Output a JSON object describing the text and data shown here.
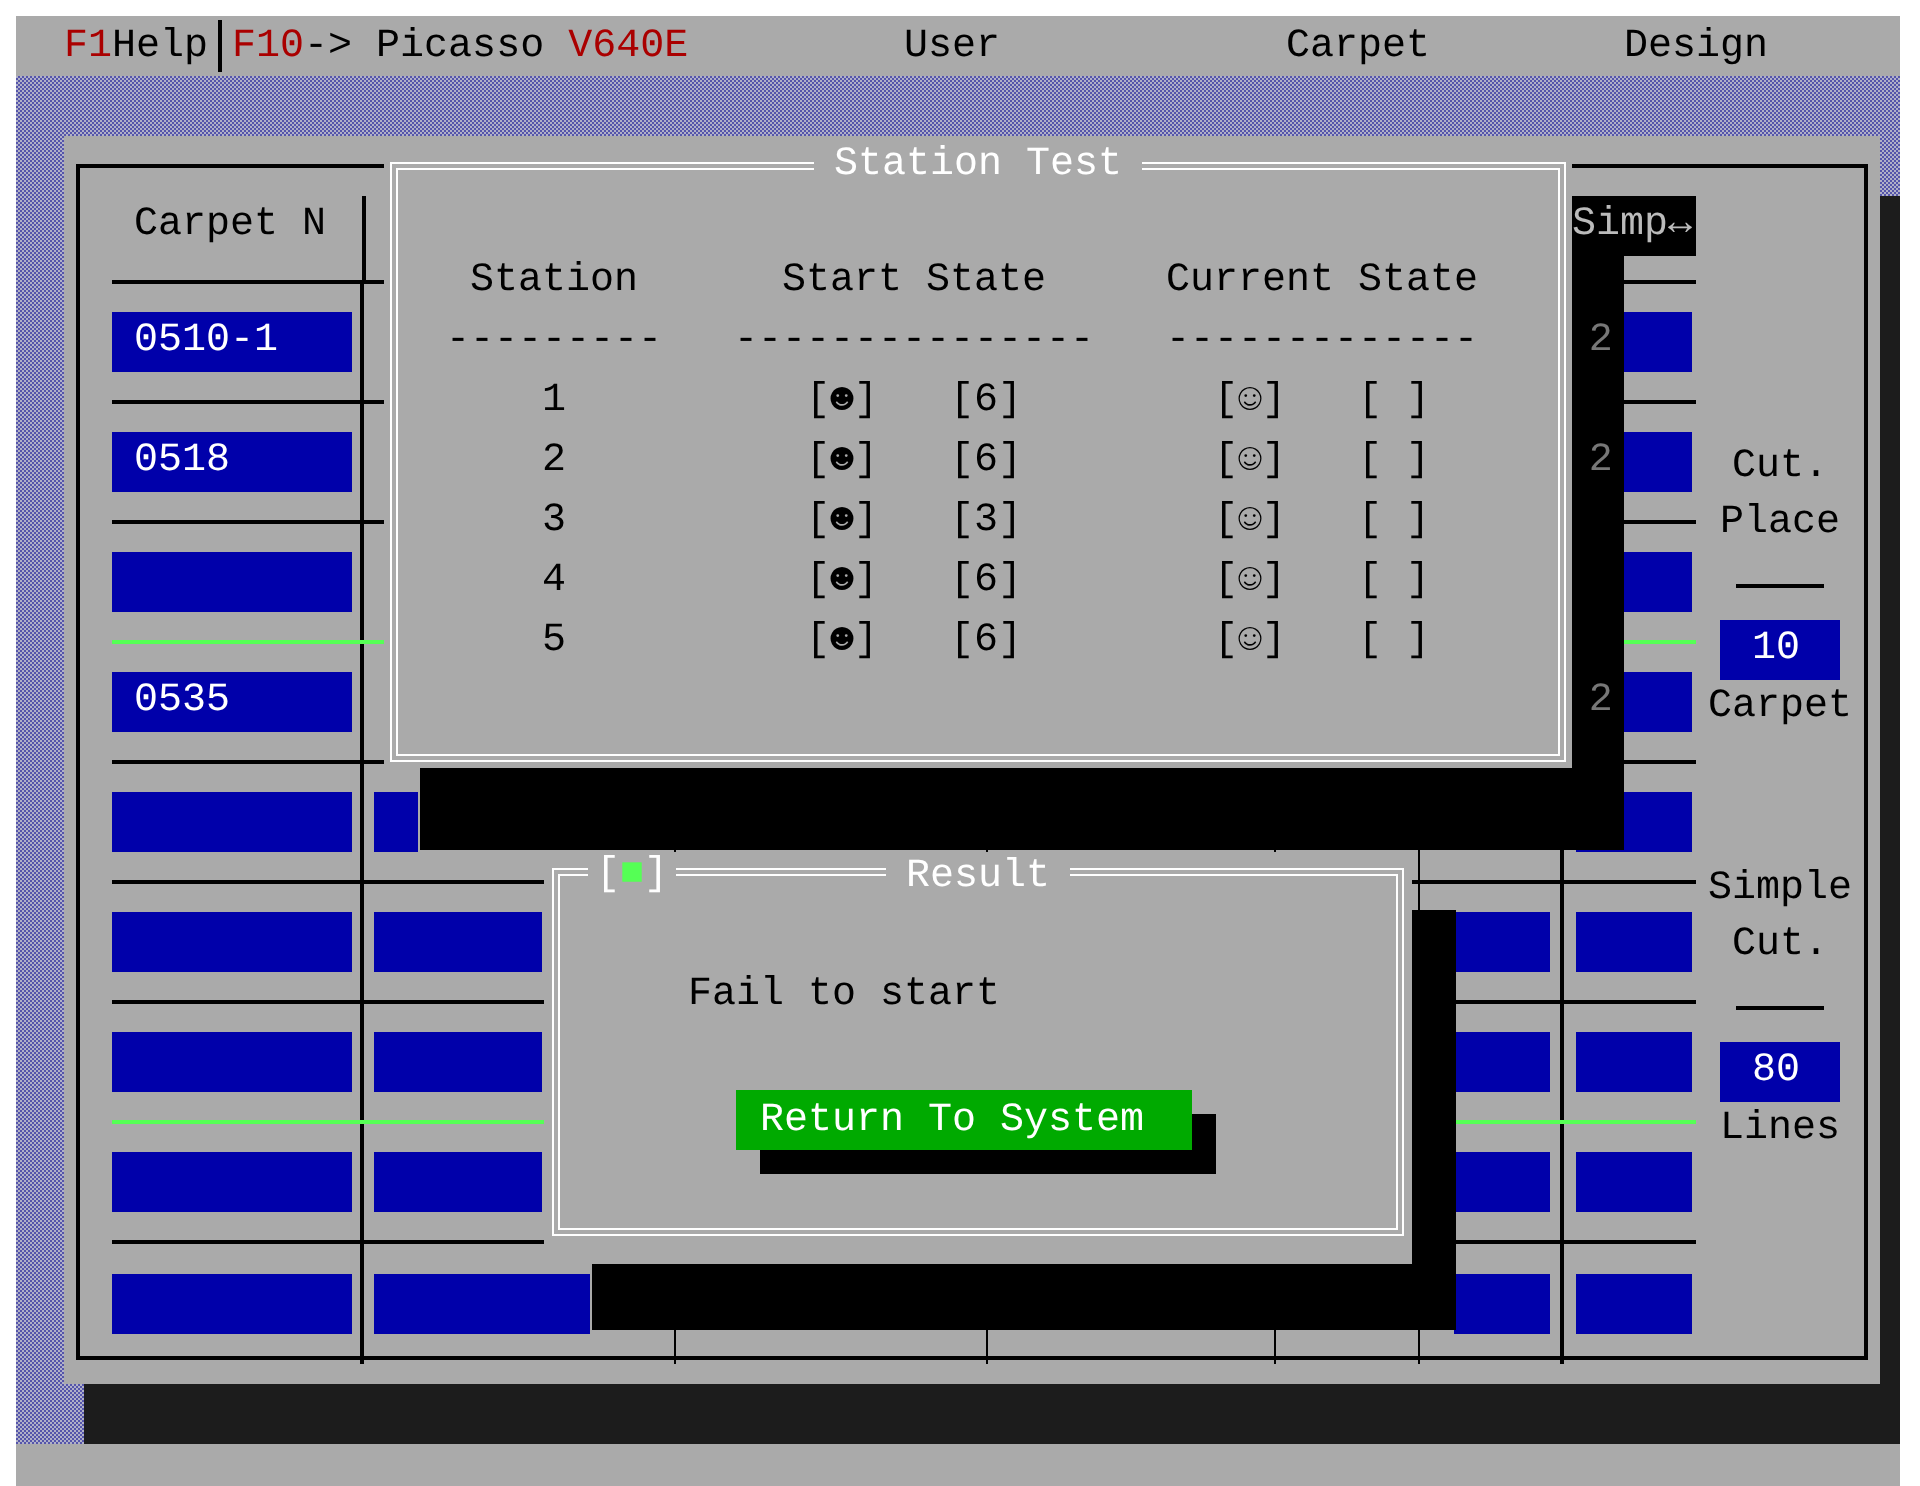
{
  "top_bar": {
    "hotkeys": [
      {
        "key": "F1",
        "label": "Help"
      },
      {
        "key": "F10",
        "label": "-> Picasso",
        "version": "V640E"
      }
    ],
    "menus": [
      "User",
      "Carpet",
      "Design"
    ]
  },
  "table": {
    "headers": {
      "carpet_no": "Carpet N",
      "column_7": "Simp↔"
    },
    "rows": [
      {
        "carpet_no": "0510-1",
        "column_7": "2",
        "highlighted_line": false
      },
      {
        "carpet_no": "0518",
        "column_7": "2",
        "highlighted_line": false
      },
      {
        "highlighted_line": true
      },
      {
        "carpet_no": "0535",
        "column_7": "2",
        "highlighted_line": false
      },
      {
        "highlighted_line": false
      },
      {
        "highlighted_line": false
      },
      {
        "highlighted_line": true
      },
      {
        "highlighted_line": false
      },
      {}
    ]
  },
  "sidebar": [
    {
      "labels": [
        "Cut.",
        "Place"
      ],
      "value": "10",
      "caption": "Carpet"
    },
    {
      "labels": [
        "Simple",
        "Cut."
      ],
      "value": "80",
      "caption": "Lines"
    }
  ],
  "station_test": {
    "title": "Station Test",
    "columns": [
      "Station",
      "Start State",
      "Current State"
    ],
    "dividers": [
      "---------",
      "---------------",
      "-------------"
    ],
    "rows": [
      {
        "station": "1",
        "start_mark": "[☻]",
        "start_count": "[6]",
        "current_mark": "[☺]",
        "current_count": "[ ]"
      },
      {
        "station": "2",
        "start_mark": "[☻]",
        "start_count": "[6]",
        "current_mark": "[☺]",
        "current_count": "[ ]"
      },
      {
        "station": "3",
        "start_mark": "[☻]",
        "start_count": "[3]",
        "current_mark": "[☺]",
        "current_count": "[ ]"
      },
      {
        "station": "4",
        "start_mark": "[☻]",
        "start_count": "[6]",
        "current_mark": "[☺]",
        "current_count": "[ ]"
      },
      {
        "station": "5",
        "start_mark": "[☻]",
        "start_count": "[6]",
        "current_mark": "[☺]",
        "current_count": "[ ]"
      }
    ]
  },
  "result": {
    "close_box": "[■]",
    "title": "Result",
    "message": "Fail to start",
    "button": "Return To System"
  }
}
